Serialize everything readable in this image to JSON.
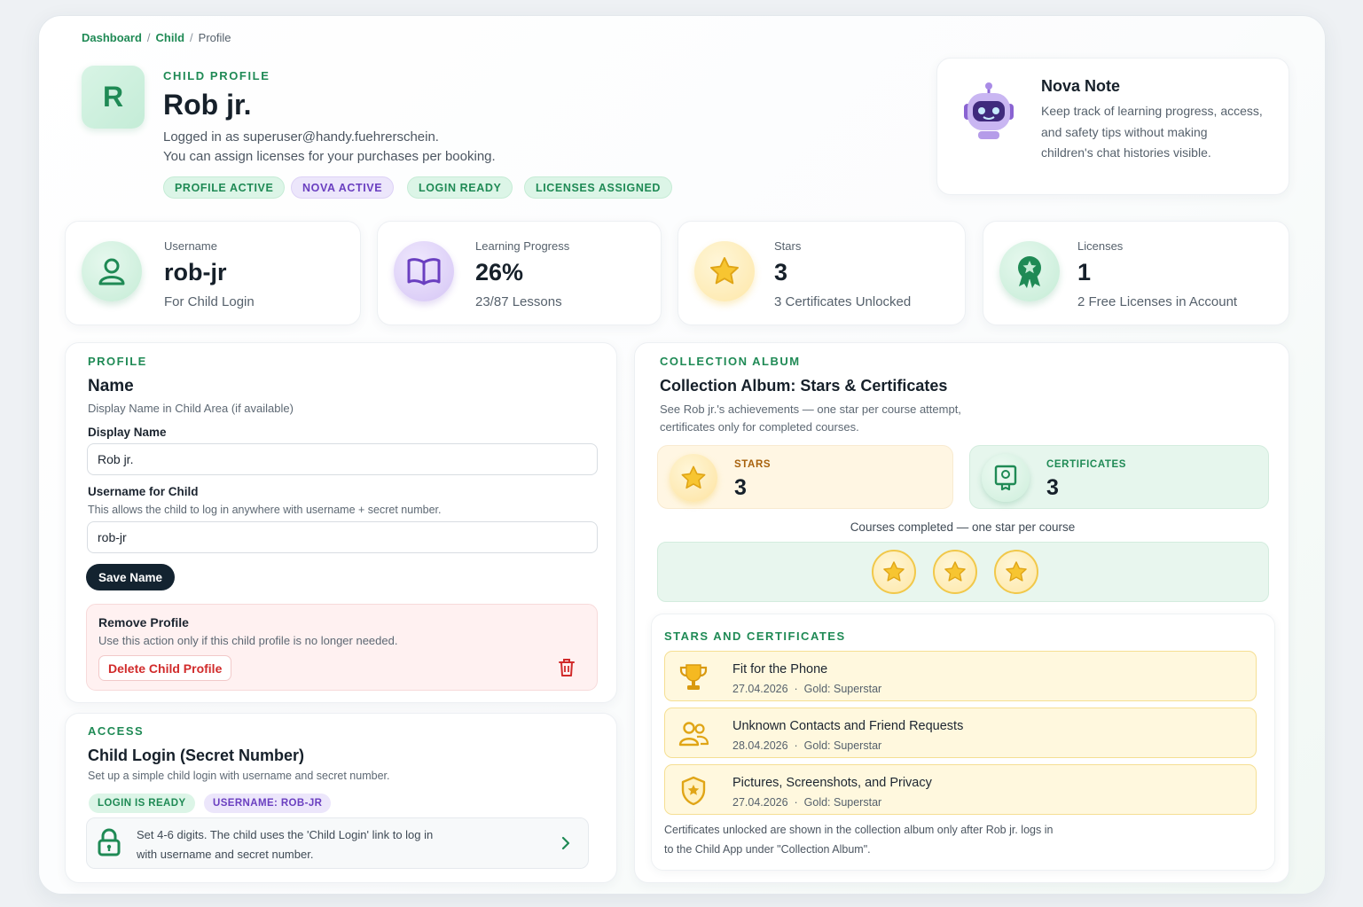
{
  "breadcrumb": {
    "dashboard": "Dashboard",
    "child": "Child",
    "current": "Profile"
  },
  "header": {
    "avatar_letter": "R",
    "eyebrow": "CHILD PROFILE",
    "name": "Rob jr.",
    "logged_in": "Logged in as superuser@handy.fuehrerschein.",
    "assign_note": "You can assign licenses for your purchases per booking.",
    "badges": [
      "PROFILE ACTIVE",
      "NOVA ACTIVE",
      "LOGIN READY",
      "LICENSES ASSIGNED"
    ]
  },
  "nova": {
    "title": "Nova Note",
    "text": "Keep track of learning progress, access, and safety tips without making children's chat histories visible."
  },
  "stats": {
    "username": {
      "label": "Username",
      "value": "rob-jr",
      "caption": "For Child Login"
    },
    "progress": {
      "label": "Learning Progress",
      "value": "26%",
      "caption": "23/87 Lessons"
    },
    "stars": {
      "label": "Stars",
      "value": "3",
      "caption": "3 Certificates Unlocked"
    },
    "licenses": {
      "label": "Licenses",
      "value": "1",
      "caption": "2 Free Licenses in Account"
    }
  },
  "profile": {
    "section": "PROFILE",
    "title": "Name",
    "desc": "Display Name in Child Area (if available)",
    "display_label": "Display Name",
    "display_value": "Rob jr.",
    "username_label": "Username for Child",
    "username_desc": "This allows the child to log in anywhere with username + secret number.",
    "username_value": "rob-jr",
    "save_label": "Save Name",
    "remove_title": "Remove Profile",
    "remove_desc": "Use this action only if this child profile is no longer needed.",
    "delete_label": "Delete Child Profile"
  },
  "access": {
    "section": "ACCESS",
    "title": "Child Login (Secret Number)",
    "desc": "Set up a simple child login with username and secret number.",
    "tag_ready": "LOGIN IS READY",
    "tag_username": "USERNAME: ROB-JR",
    "hint_line1": "Set 4-6 digits. The child uses the 'Child Login' link to log in",
    "hint_line2": "with username and secret number."
  },
  "collection": {
    "section": "COLLECTION ALBUM",
    "title": "Collection Album: Stars & Certificates",
    "desc_line1": "See Rob jr.'s achievements — one star per course attempt,",
    "desc_line2": "certificates only for completed courses.",
    "stars_label": "STARS",
    "stars_value": "3",
    "certs_label": "CERTIFICATES",
    "certs_value": "3",
    "courses_caption": "Courses completed — one star per course",
    "star_count": 3
  },
  "achievements": {
    "section": "STARS AND CERTIFICATES",
    "items": [
      {
        "title": "Fit for the Phone",
        "date": "27.04.2026",
        "level": "Gold: Superstar",
        "icon": "trophy-icon"
      },
      {
        "title": "Unknown Contacts and Friend Requests",
        "date": "28.04.2026",
        "level": "Gold: Superstar",
        "icon": "people-icon"
      },
      {
        "title": "Pictures, Screenshots, and Privacy",
        "date": "27.04.2026",
        "level": "Gold: Superstar",
        "icon": "shield-star-icon"
      }
    ],
    "separator": "·",
    "footer_line1": "Certificates unlocked are shown in the collection album only after Rob jr. logs in",
    "footer_line2": "to the Child App under \"Collection Album\"."
  },
  "colors": {
    "accent_green": "#1f8a55",
    "accent_purple": "#6a3fc0",
    "danger_red": "#d12b2b",
    "gold": "#f1c84a",
    "dark_button": "#132330"
  }
}
